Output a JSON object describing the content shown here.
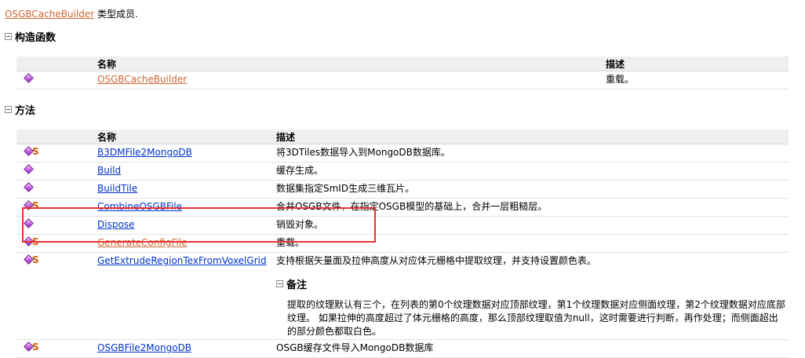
{
  "intro": {
    "link": "OSGBCacheBuilder",
    "suffix": " 类型成员."
  },
  "constructors": {
    "heading": "构造函数",
    "col_name": "名称",
    "col_desc": "描述",
    "rows": [
      {
        "name": "OSGBCacheBuilder",
        "desc": "重载。"
      }
    ]
  },
  "methods": {
    "heading": "方法",
    "col_name": "名称",
    "col_desc": "描述",
    "rows": [
      {
        "name": "B3DMFile2MongoDB",
        "desc": "将3DTiles数据导入到MongoDB数据库。"
      },
      {
        "name": "Build",
        "desc": "缓存生成。"
      },
      {
        "name": "BuildTile",
        "desc": "数据集指定SmID生成三维瓦片。"
      },
      {
        "name": "CombineOSGBFile",
        "desc": "合并OSGB文件，在指定OSGB模型的基础上，合并一层粗糙层。"
      },
      {
        "name": "Dispose",
        "desc": "销毁对象。"
      },
      {
        "name": "GenerateConfigFile",
        "desc": "重载。"
      },
      {
        "name": "GetExtrudeRegionTexFromVoxelGrid",
        "desc": "支持根据矢量面及拉伸高度从对应体元栅格中提取纹理，并支持设置颜色表。",
        "notes_heading": "备注",
        "notes_text": "提取的纹理默认有三个，在列表的第0个纹理数据对应顶部纹理，第1个纹理数据对应侧面纹理，第2个纹理数据对应底部纹理。 如果拉伸的高度超过了体元栅格的高度，那么顶部纹理取值为null，这时需要进行判断，再作处理；而侧面超出的部分颜色都取白色。"
      },
      {
        "name": "OSGBFile2MongoDB",
        "desc": "OSGB缓存文件导入MongoDB数据库"
      }
    ]
  },
  "colors": {
    "link": "#0033cc",
    "visited_link": "#cc6633",
    "highlight": "#e83232",
    "header_bg": "#efefef"
  }
}
